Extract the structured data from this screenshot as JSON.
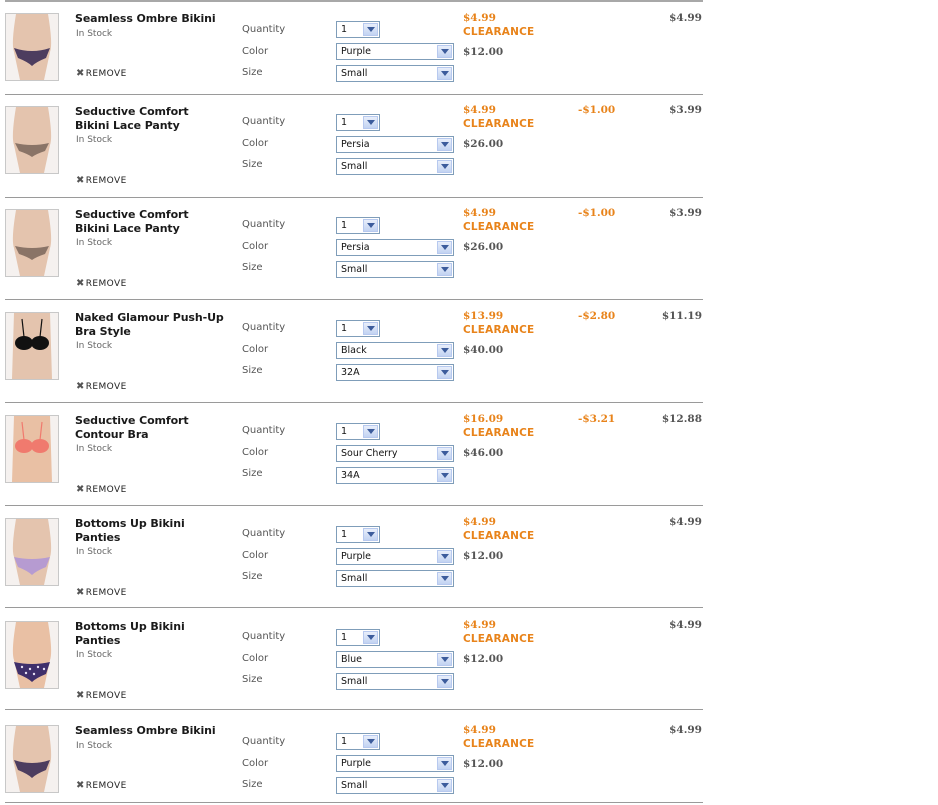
{
  "labels": {
    "in_stock": "In Stock",
    "remove": "REMOVE",
    "quantity": "Quantity",
    "color": "Color",
    "size": "Size",
    "clearance": "CLEARANCE"
  },
  "colors": {
    "price_accent": "#e8831a",
    "separator": "#9a9a9a",
    "select_border": "#7f9db9"
  },
  "items": [
    {
      "name": "Seamless Ombre Bikini",
      "quantity": "1",
      "color": "Purple",
      "size": "Small",
      "sale_price": "$4.99",
      "original_price": "$12.00",
      "discount": "",
      "total": "$4.99",
      "image": "purple-bikini-photo"
    },
    {
      "name": "Seductive Comfort Bikini Lace Panty",
      "quantity": "1",
      "color": "Persia",
      "size": "Small",
      "sale_price": "$4.99",
      "original_price": "$26.00",
      "discount": "-$1.00",
      "total": "$3.99",
      "image": "mocha-lace-panty-photo"
    },
    {
      "name": "Seductive Comfort Bikini Lace Panty",
      "quantity": "1",
      "color": "Persia",
      "size": "Small",
      "sale_price": "$4.99",
      "original_price": "$26.00",
      "discount": "-$1.00",
      "total": "$3.99",
      "image": "mocha-lace-panty-photo"
    },
    {
      "name": "Naked Glamour Push-Up Bra Style",
      "quantity": "1",
      "color": "Black",
      "size": "32A",
      "sale_price": "$13.99",
      "original_price": "$40.00",
      "discount": "-$2.80",
      "total": "$11.19",
      "image": "black-bra-photo"
    },
    {
      "name": "Seductive Comfort Contour Bra",
      "quantity": "1",
      "color": "Sour Cherry",
      "size": "34A",
      "sale_price": "$16.09",
      "original_price": "$46.00",
      "discount": "-$3.21",
      "total": "$12.88",
      "image": "coral-bra-photo"
    },
    {
      "name": "Bottoms Up Bikini Panties",
      "quantity": "1",
      "color": "Purple",
      "size": "Small",
      "sale_price": "$4.99",
      "original_price": "$12.00",
      "discount": "",
      "total": "$4.99",
      "image": "lilac-bikini-photo"
    },
    {
      "name": "Bottoms Up Bikini Panties",
      "quantity": "1",
      "color": "Blue",
      "size": "Small",
      "sale_price": "$4.99",
      "original_price": "$12.00",
      "discount": "",
      "total": "$4.99",
      "image": "navy-print-bikini-photo"
    },
    {
      "name": "Seamless Ombre Bikini",
      "quantity": "1",
      "color": "Purple",
      "size": "Small",
      "sale_price": "$4.99",
      "original_price": "$12.00",
      "discount": "",
      "total": "$4.99",
      "image": "purple-bikini-photo"
    }
  ]
}
